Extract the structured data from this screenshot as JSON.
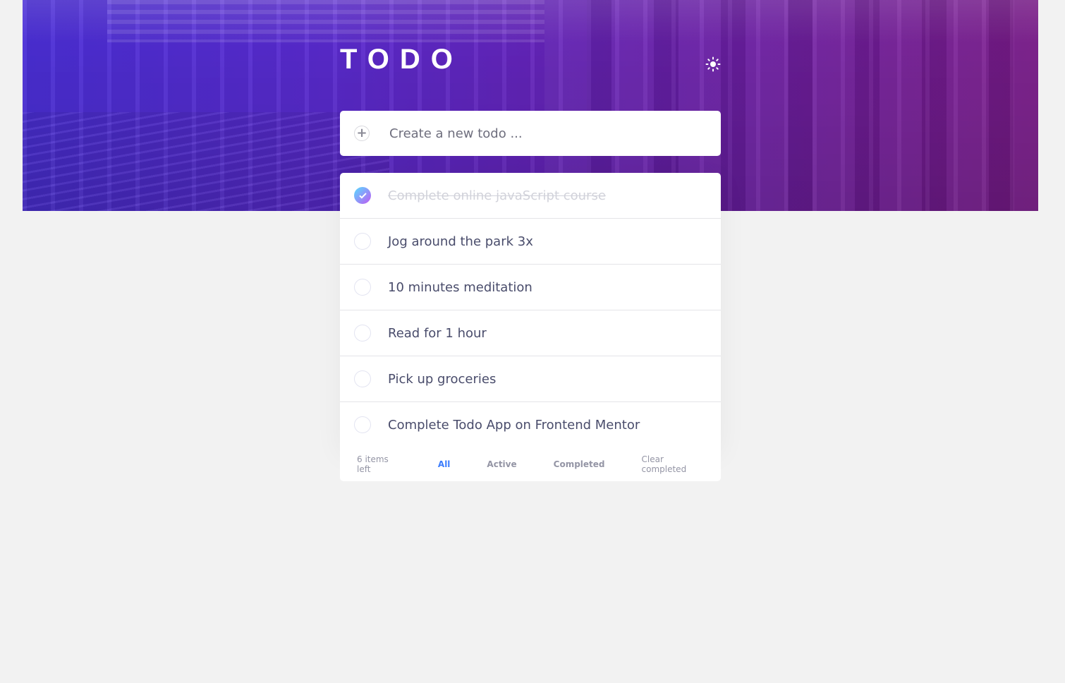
{
  "app": {
    "title": "TODO"
  },
  "theme_toggle": {
    "icon": "sun-icon"
  },
  "new_todo": {
    "placeholder": "Create a new todo ..."
  },
  "todos": [
    {
      "text": "Complete online javaScript course",
      "completed": true
    },
    {
      "text": "Jog around the park 3x",
      "completed": false
    },
    {
      "text": "10 minutes meditation",
      "completed": false
    },
    {
      "text": "Read for 1 hour",
      "completed": false
    },
    {
      "text": "Pick up groceries",
      "completed": false
    },
    {
      "text": "Complete Todo App on Frontend Mentor",
      "completed": false
    }
  ],
  "footer": {
    "items_left": "6 items left",
    "filters": [
      {
        "label": "All",
        "active": true
      },
      {
        "label": "Active",
        "active": false
      },
      {
        "label": "Completed",
        "active": false
      }
    ],
    "clear_label": "Clear completed"
  },
  "colors": {
    "accent": "#3a7cfd",
    "check_gradient_start": "#57ddff",
    "check_gradient_end": "#c058f3",
    "text": "#494c6b",
    "completed_text": "#d1d2da",
    "background": "#f2f2f2"
  }
}
